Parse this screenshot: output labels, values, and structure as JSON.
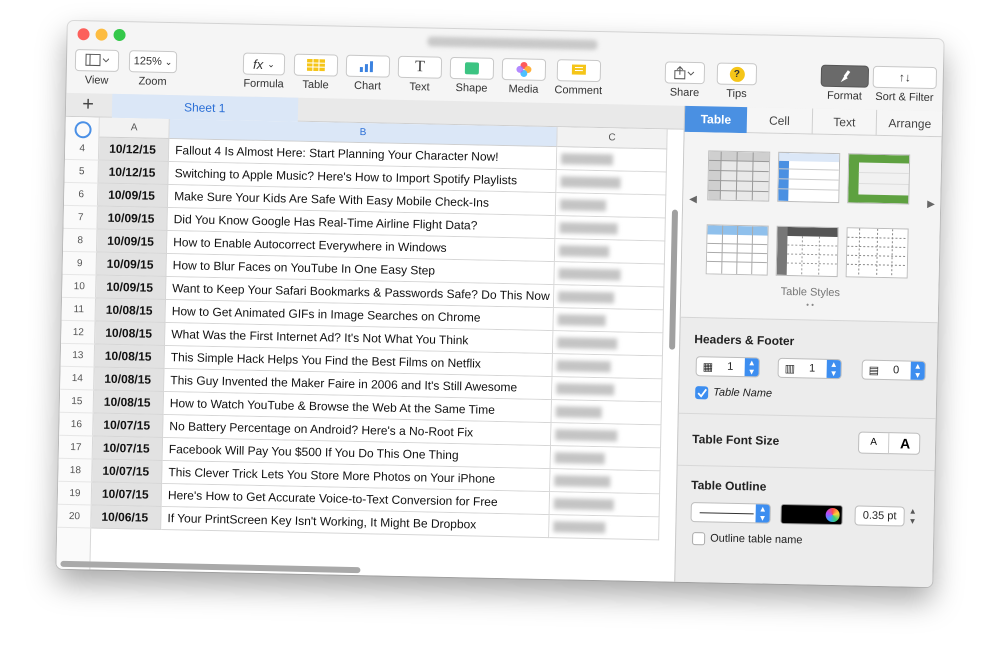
{
  "toolbar": {
    "view": "View",
    "zoom_value": "125%",
    "zoom": "Zoom",
    "formula_icon": "fx",
    "formula": "Formula",
    "table": "Table",
    "chart": "Chart",
    "text_icon": "T",
    "text": "Text",
    "shape": "Shape",
    "media": "Media",
    "comment": "Comment",
    "share": "Share",
    "tips_icon": "?",
    "tips": "Tips",
    "format": "Format",
    "sort_icon": "↑↓",
    "sort": "Sort & Filter"
  },
  "sheet_tab": "Sheet 1",
  "columns": [
    "A",
    "B",
    "C"
  ],
  "rows": [
    {
      "n": "4",
      "date": "10/12/15",
      "title": "Fallout 4 Is Almost Here: Start Planning Your Character Now!"
    },
    {
      "n": "5",
      "date": "10/12/15",
      "title": "Switching to Apple Music? Here's How to Import Spotify Playlists"
    },
    {
      "n": "6",
      "date": "10/09/15",
      "title": "Make Sure Your Kids Are Safe With Easy Mobile Check-Ins"
    },
    {
      "n": "7",
      "date": "10/09/15",
      "title": "Did You Know Google Has Real-Time Airline Flight Data?"
    },
    {
      "n": "8",
      "date": "10/09/15",
      "title": "How to Enable Autocorrect Everywhere in Windows"
    },
    {
      "n": "9",
      "date": "10/09/15",
      "title": "How to Blur Faces on YouTube In One Easy Step"
    },
    {
      "n": "10",
      "date": "10/09/15",
      "title": "Want to Keep Your Safari Bookmarks & Passwords Safe? Do This Now"
    },
    {
      "n": "11",
      "date": "10/08/15",
      "title": "How to Get Animated GIFs in Image Searches on Chrome"
    },
    {
      "n": "12",
      "date": "10/08/15",
      "title": "What Was the First Internet Ad? It's Not What You Think"
    },
    {
      "n": "13",
      "date": "10/08/15",
      "title": "This Simple Hack Helps You Find the Best Films on Netflix"
    },
    {
      "n": "14",
      "date": "10/08/15",
      "title": "This Guy Invented the Maker Faire in 2006 and It's Still Awesome"
    },
    {
      "n": "15",
      "date": "10/08/15",
      "title": "How to Watch YouTube & Browse the Web At the Same Time"
    },
    {
      "n": "16",
      "date": "10/07/15",
      "title": "No Battery Percentage on Android? Here's a No-Root Fix"
    },
    {
      "n": "17",
      "date": "10/07/15",
      "title": "Facebook Will Pay You $500 If You Do This One Thing"
    },
    {
      "n": "18",
      "date": "10/07/15",
      "title": "This Clever Trick Lets You Store More Photos on Your iPhone"
    },
    {
      "n": "19",
      "date": "10/07/15",
      "title": "Here's How to Get Accurate Voice-to-Text Conversion for Free"
    },
    {
      "n": "20",
      "date": "10/06/15",
      "title": "If Your PrintScreen Key Isn't Working, It Might Be Dropbox"
    }
  ],
  "panel": {
    "tabs": [
      "Table",
      "Cell",
      "Text",
      "Arrange"
    ],
    "table_styles": "Table Styles",
    "headers_footer": "Headers & Footer",
    "header_rows": "1",
    "header_cols": "1",
    "footer_rows": "0",
    "table_name": "Table Name",
    "table_font_size": "Table Font Size",
    "font_small": "A",
    "font_large": "A",
    "table_outline": "Table Outline",
    "outline_width": "0.35 pt",
    "outline_table_name": "Outline table name"
  },
  "colors": {
    "accent": "#4a90e2",
    "close": "#fc605b",
    "minimize": "#fdbc40",
    "zoom": "#34c84a"
  }
}
